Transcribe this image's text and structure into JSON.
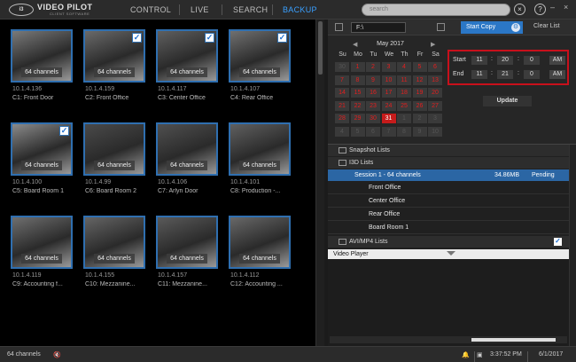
{
  "app": {
    "logo_text": "i3",
    "name": "VIDEO PILOT",
    "subtitle": "CLIENT SOFTWARE"
  },
  "nav": {
    "items": [
      "CONTROL",
      "LIVE",
      "SEARCH",
      "BACKUP"
    ],
    "active": "BACKUP"
  },
  "search": {
    "placeholder": "search"
  },
  "top_icons": {
    "help": "?"
  },
  "cameras": [
    {
      "label": "64 channels",
      "ip": "10.1.4.136",
      "name": "C1: Front Door",
      "checked": false
    },
    {
      "label": "64 channels",
      "ip": "10.1.4.159",
      "name": "C2: Front Office",
      "checked": true
    },
    {
      "label": "64 channels",
      "ip": "10.1.4.117",
      "name": "C3: Center Office",
      "checked": true
    },
    {
      "label": "64 channels",
      "ip": "10.1.4.107",
      "name": "C4: Rear Office",
      "checked": true
    },
    {
      "label": "64 channels",
      "ip": "10.1.4.100",
      "name": "C5: Board Room 1",
      "checked": true
    },
    {
      "label": "64 channels",
      "ip": "10.1.4.99",
      "name": "C6: Board Room 2",
      "checked": false
    },
    {
      "label": "64 channels",
      "ip": "10.1.4.106",
      "name": "C7: Arlyn Door",
      "checked": false
    },
    {
      "label": "64 channels",
      "ip": "10.1.4.101",
      "name": "C8: Production -...",
      "checked": false
    },
    {
      "label": "64 channels",
      "ip": "10.1.4.119",
      "name": "C9: Accounting f...",
      "checked": false
    },
    {
      "label": "64 channels",
      "ip": "10.1.4.155",
      "name": "C10: Mezzanine...",
      "checked": false
    },
    {
      "label": "64 channels",
      "ip": "10.1.4.157",
      "name": "C11: Mezzanine...",
      "checked": false
    },
    {
      "label": "64 channels",
      "ip": "10.1.4.112",
      "name": "C12: Accounting ...",
      "checked": false
    }
  ],
  "backup": {
    "path": "F:\\",
    "start_copy": "Start Copy",
    "clear_list": "Clear List",
    "calendar": {
      "month": "May 2017",
      "weekdays": [
        "Su",
        "Mo",
        "Tu",
        "We",
        "Th",
        "Fr",
        "Sa"
      ],
      "days": [
        "30",
        "1",
        "2",
        "3",
        "4",
        "5",
        "6",
        "7",
        "8",
        "9",
        "10",
        "11",
        "12",
        "13",
        "14",
        "15",
        "16",
        "17",
        "18",
        "19",
        "20",
        "21",
        "22",
        "23",
        "24",
        "25",
        "26",
        "27",
        "28",
        "29",
        "30",
        "31",
        "1",
        "2",
        "3",
        "4",
        "5",
        "6",
        "7",
        "8",
        "9",
        "10"
      ],
      "selected": "31"
    },
    "start": {
      "label": "Start",
      "h": "11",
      "m": "20",
      "s": "0",
      "ampm": "AM"
    },
    "end": {
      "label": "End",
      "h": "11",
      "m": "21",
      "s": "0",
      "ampm": "AM"
    },
    "update": "Update"
  },
  "lists": {
    "snapshot": "Snapshot Lists",
    "i3d": "I3D Lists",
    "session": {
      "name": "Session 1 - 64 channels",
      "size": "34.86MB",
      "status": "Pending"
    },
    "session_items": [
      "Front Office",
      "Center Office",
      "Rear Office",
      "Board Room 1"
    ],
    "avi": "AVI/MP4 Lists",
    "video_player": "Video Player"
  },
  "status": {
    "channels": "64 channels",
    "time": "3:37:52 PM",
    "date": "6/1/2017"
  },
  "colors": {
    "accent": "#3aa0ff",
    "highlight": "#2b66a4",
    "red": "#c8101b"
  }
}
